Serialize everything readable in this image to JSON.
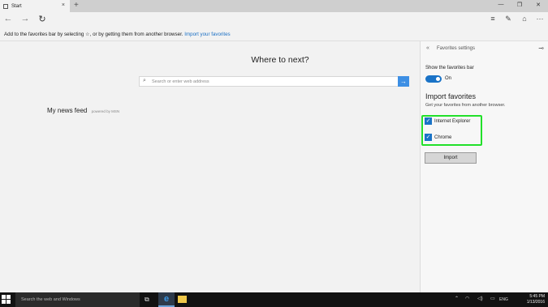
{
  "tab": {
    "title": "Start",
    "icon": "page-icon",
    "close_glyph": "×",
    "new_tab_glyph": "+"
  },
  "window_controls": {
    "minimize": "—",
    "maximize": "❐",
    "close": "✕"
  },
  "nav": {
    "back": "←",
    "forward": "→",
    "refresh": "↻"
  },
  "toolbar": {
    "hub": "≡",
    "note": "✎",
    "share": "⌂",
    "more": "···"
  },
  "infobar": {
    "text": "Add to the favorites bar by selecting ☆, or by getting them from another browser.",
    "link": "Import your favorites"
  },
  "main": {
    "heading": "Where to next?",
    "search_placeholder": "Search or enter web address",
    "search_go": "→",
    "news_title": "My news feed",
    "news_powered": "powered by MSN"
  },
  "panel": {
    "back_glyph": "«",
    "title": "Favorites settings",
    "pin_glyph": "⊸",
    "show_bar_label": "Show the favorites bar",
    "toggle_state": "On",
    "import_heading": "Import favorites",
    "import_sub": "Get your favorites from another browser.",
    "browsers": [
      {
        "label": "Internet Explorer",
        "checked": true
      },
      {
        "label": "Chrome",
        "checked": true
      }
    ],
    "check_glyph": "✓",
    "import_button": "Import"
  },
  "taskbar": {
    "search_text": "Search the web and Windows",
    "taskview": "⧉",
    "edge": "e",
    "tray_chevron": "⌃",
    "tray_wifi": "◠",
    "tray_volume": "◁)",
    "tray_msg": "▭",
    "tray_lang": "ENG",
    "time": "5:45 PM",
    "date": "1/13/2016"
  },
  "colors": {
    "accent": "#1a73c7",
    "highlight": "#22e02a",
    "link": "#1a6fc4"
  }
}
